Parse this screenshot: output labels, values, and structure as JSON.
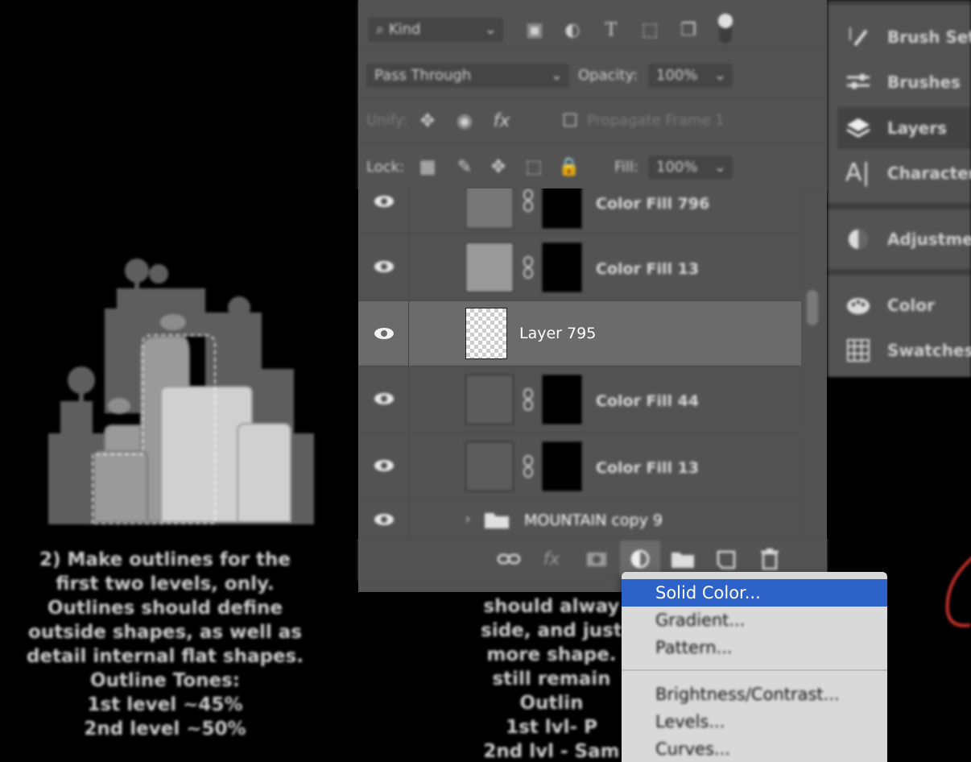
{
  "left_caption": {
    "lines": [
      "2) Make outlines for the",
      "first two levels, only.",
      "Outlines should define",
      "outside shapes, as well as",
      "detail internal flat shapes.",
      "Outline Tones:",
      "1st level ~45%",
      "2nd level ~50%"
    ]
  },
  "mid_caption": {
    "lines": [
      "should alway",
      "side, and just",
      "more shape.",
      "still remain",
      "Outlin",
      "1st lvl- P",
      "2nd lvl - Sam"
    ]
  },
  "layers_panel": {
    "filter": {
      "kind_label": "Kind"
    },
    "blend_mode": "Pass Through",
    "opacity_label": "Opacity:",
    "opacity_value": "100%",
    "unify_label": "Unify:",
    "propagate_label": "Propagate Frame 1",
    "lock_label": "Lock:",
    "fill_label": "Fill:",
    "fill_value": "100%",
    "layers": [
      {
        "name": "Color Fill 796",
        "selected": false
      },
      {
        "name": "Color Fill 13",
        "selected": false
      },
      {
        "name": "Layer 795",
        "selected": true
      },
      {
        "name": "Color Fill 44",
        "selected": false
      },
      {
        "name": "Color Fill 13",
        "selected": false
      },
      {
        "name": "MOUNTAIN copy 9",
        "selected": false,
        "is_group": true
      }
    ]
  },
  "dock": {
    "items": [
      {
        "label": "Brush Setti",
        "icon": "brush-settings-icon"
      },
      {
        "label": "Brushes",
        "icon": "brushes-icon"
      },
      {
        "label": "Layers",
        "icon": "layers-icon",
        "selected": true
      },
      {
        "label": "Character",
        "icon": "character-icon"
      },
      {
        "label": "Adjustmen",
        "icon": "adjustments-icon"
      },
      {
        "label": "Color",
        "icon": "color-palette-icon"
      },
      {
        "label": "Swatches",
        "icon": "swatches-icon"
      }
    ]
  },
  "adjustment_menu": {
    "items": [
      {
        "label": "Solid Color...",
        "highlighted": true
      },
      {
        "label": "Gradient..."
      },
      {
        "label": "Pattern..."
      },
      {
        "label": "Brightness/Contrast..."
      },
      {
        "label": "Levels..."
      },
      {
        "label": "Curves..."
      }
    ]
  },
  "colors": {
    "panel_bg": "#535353",
    "selected_row": "#6b6b6b",
    "menu_highlight": "#2d62c8",
    "menu_bg": "#d9d9d9"
  }
}
